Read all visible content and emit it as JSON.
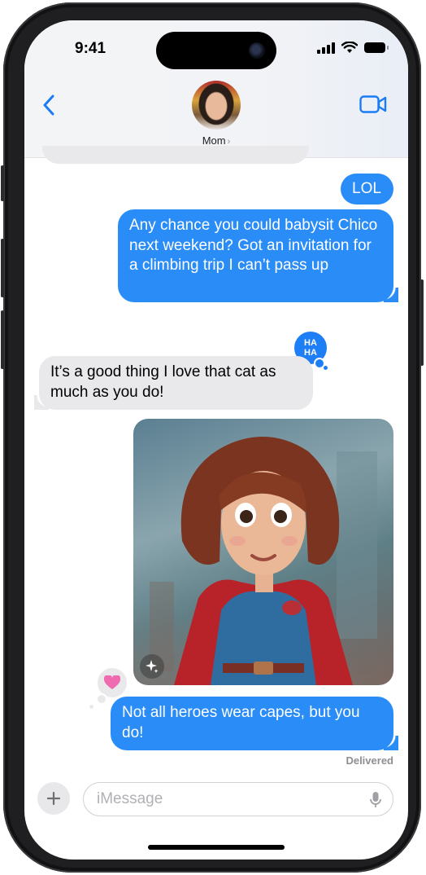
{
  "status_bar": {
    "time": "9:41"
  },
  "header": {
    "contact_name": "Mom",
    "chevron": "›",
    "back_icon": "chevron-left-icon",
    "video_icon": "video-camera-icon"
  },
  "messages": [
    {
      "sender": "me",
      "text": "LOL"
    },
    {
      "sender": "me",
      "text": "Any chance you could babysit Chico next weekend? Got an invitation for a climbing trip I can’t pass up"
    },
    {
      "sender": "mom",
      "text": "It’s a good thing I love that cat as much as you do!"
    },
    {
      "sender": "me",
      "type": "image",
      "description_icon": "genmoji-superhero-image"
    },
    {
      "sender": "me",
      "text": "Not all heroes wear capes, but you do!"
    }
  ],
  "tapbacks": {
    "haha": "HA\nHA",
    "heart_icon": "heart-icon"
  },
  "delivered_label": "Delivered",
  "input": {
    "placeholder": "iMessage",
    "plus_icon": "plus-icon",
    "mic_icon": "microphone-icon"
  },
  "colors": {
    "outgoing_bubble": "#2a8cf7",
    "incoming_bubble": "#e9e9eb",
    "accent": "#1d7ef5"
  }
}
